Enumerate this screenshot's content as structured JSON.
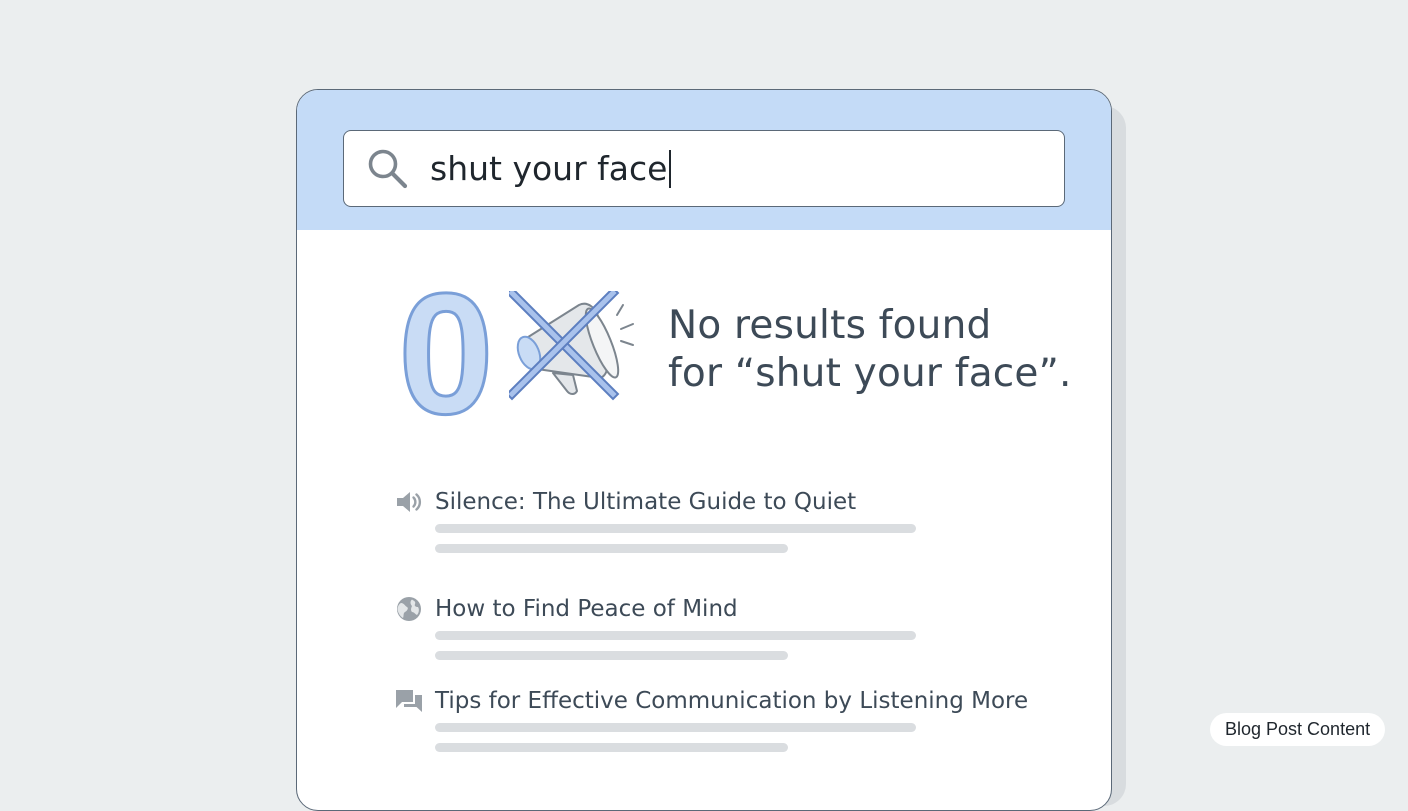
{
  "search": {
    "query": "shut your face",
    "icon": "search-icon"
  },
  "empty_state": {
    "count": "0",
    "line1": "No results found",
    "line2": "for “shut your face”.",
    "icon": "muted-megaphone-icon"
  },
  "suggestions": [
    {
      "icon": "speaker-icon",
      "title": "Silence: The Ultimate Guide to Quiet"
    },
    {
      "icon": "globe-icon",
      "title": "How to Find Peace of Mind"
    },
    {
      "icon": "chat-bubbles-icon",
      "title": "Tips for Effective Communication by Listening More"
    }
  ],
  "badge": {
    "label": "Blog Post Content"
  },
  "colors": {
    "background": "#ebeeef",
    "header": "#c4dbf7",
    "accent": "#7a9fd8",
    "text": "#3d4a57"
  }
}
